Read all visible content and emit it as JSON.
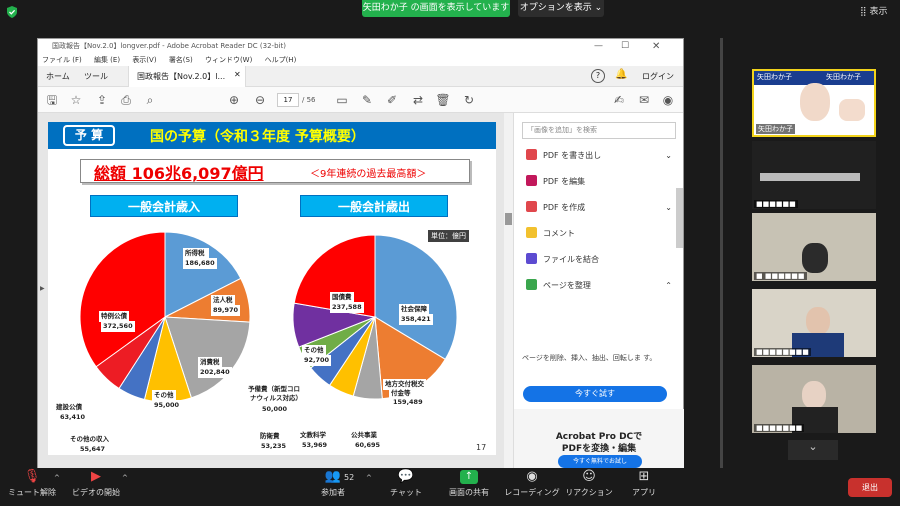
{
  "zoom": {
    "share_banner": "矢田わか子 の画面を表示しています",
    "view_options": "オプションを表示",
    "view_toggle": "表示",
    "leave": "退出",
    "bottom": [
      {
        "label": "ミュート解除",
        "icon": "mic-muted-icon"
      },
      {
        "label": "ビデオの開始",
        "icon": "video-off-icon"
      },
      {
        "label": "参加者",
        "icon": "participants-icon",
        "count": "52"
      },
      {
        "label": "チャット",
        "icon": "chat-icon"
      },
      {
        "label": "画面の共有",
        "icon": "share-screen-icon"
      },
      {
        "label": "レコーディング",
        "icon": "record-icon"
      },
      {
        "label": "リアクション",
        "icon": "reaction-icon"
      },
      {
        "label": "アプリ",
        "icon": "apps-icon"
      }
    ],
    "videos": [
      {
        "name": "矢田わか子",
        "banner_left": "矢田わか子",
        "banner_right": "矢田わか子"
      },
      {
        "name": "■■■■■■"
      },
      {
        "name": "■ ■■■■■■"
      },
      {
        "name": "■■■■■■■■"
      },
      {
        "name": "■■■■■■■"
      }
    ]
  },
  "acrobat": {
    "title": "国政報告【Nov.2.0】longver.pdf - Adobe Acrobat Reader DC (32-bit)",
    "menu": [
      "ファイル (F)",
      "編集 (E)",
      "表示(V)",
      "署名(S)",
      "ウィンドウ(W)",
      "ヘルプ(H)"
    ],
    "tab_home": "ホーム",
    "tab_tools": "ツール",
    "doc_tab": "国政報告【Nov.2.0】l...",
    "login": "ログイン",
    "page_current": "17",
    "page_total": "/ 56",
    "search_placeholder": "「画像を追加」を検索",
    "tools": [
      {
        "label": "PDF を書き出し",
        "color": "#e0474c",
        "chevron": true
      },
      {
        "label": "PDF を編集",
        "color": "#c2185b",
        "chevron": false
      },
      {
        "label": "PDF を作成",
        "color": "#e0474c",
        "chevron": true
      },
      {
        "label": "コメント",
        "color": "#f2c12e",
        "chevron": false
      },
      {
        "label": "ファイルを結合",
        "color": "#5c4bd1",
        "chevron": false
      },
      {
        "label": "ページを整理",
        "color": "#3aa64d",
        "chevron": true
      }
    ],
    "organize_desc": "ページを削除、挿入、抽出、回転しま す。",
    "try_now": "今すぐ試す",
    "promo_title1": "Acrobat Pro DCで",
    "promo_title2": "PDFを変換・編集",
    "promo_button": "今すぐ無料でお試し"
  },
  "slide": {
    "tag": "予 算",
    "title": "国の予算（令和３年度 予算概要）",
    "total": "総額 106兆6,097億円",
    "note": "＜9年連続の過去最高額＞",
    "page_no": "17",
    "unit": "単位：億円"
  },
  "chart_data": [
    {
      "type": "pie",
      "title": "一般会計歳入",
      "slices": [
        {
          "name": "所得税",
          "value": 186680,
          "color": "#5b9bd5"
        },
        {
          "name": "法人税",
          "value": 89970,
          "color": "#ed7d31"
        },
        {
          "name": "消費税",
          "value": 202840,
          "color": "#a5a5a5"
        },
        {
          "name": "その他",
          "value": 95000,
          "color": "#ffc000"
        },
        {
          "name": "その他の収入",
          "value": 55647,
          "color": "#4472c4"
        },
        {
          "name": "建設公債",
          "value": 63410,
          "color": "#ed1c24"
        },
        {
          "name": "特例公債",
          "value": 372560,
          "color": "#ff0000"
        }
      ]
    },
    {
      "type": "pie",
      "title": "一般会計歳出",
      "slices": [
        {
          "name": "社会保障",
          "value": 358421,
          "color": "#5b9bd5"
        },
        {
          "name": "地方交付税交付金等",
          "value": 159489,
          "color": "#ed7d31"
        },
        {
          "name": "公共事業",
          "value": 60695,
          "color": "#a5a5a5"
        },
        {
          "name": "文教科学",
          "value": 53969,
          "color": "#ffc000"
        },
        {
          "name": "防衛費",
          "value": 53235,
          "color": "#4472c4"
        },
        {
          "name": "予備費（新型コロナウィルス対応）",
          "value": 50000,
          "color": "#70ad47"
        },
        {
          "name": "その他",
          "value": 92700,
          "color": "#7030a0"
        },
        {
          "name": "国債費",
          "value": 237588,
          "color": "#ff0000"
        }
      ]
    }
  ],
  "labels_in": [
    "所得税",
    "186,680",
    "法人税",
    "89,970",
    "消費税",
    "202,840",
    "その他",
    "95,000",
    "その他の収入",
    "55,647",
    "建設公債",
    "63,410",
    "特例公債",
    "372,560"
  ],
  "labels_out": [
    "社会保障",
    "358,421",
    "地方交付税交",
    "付金等",
    "159,489",
    "公共事業",
    "60,695",
    "文教科学",
    "53,969",
    "防衛費",
    "53,235",
    "予備費（新型コロ",
    "ナウィルス対応）",
    "50,000",
    "その他",
    "92,700",
    "国債費",
    "237,588"
  ]
}
